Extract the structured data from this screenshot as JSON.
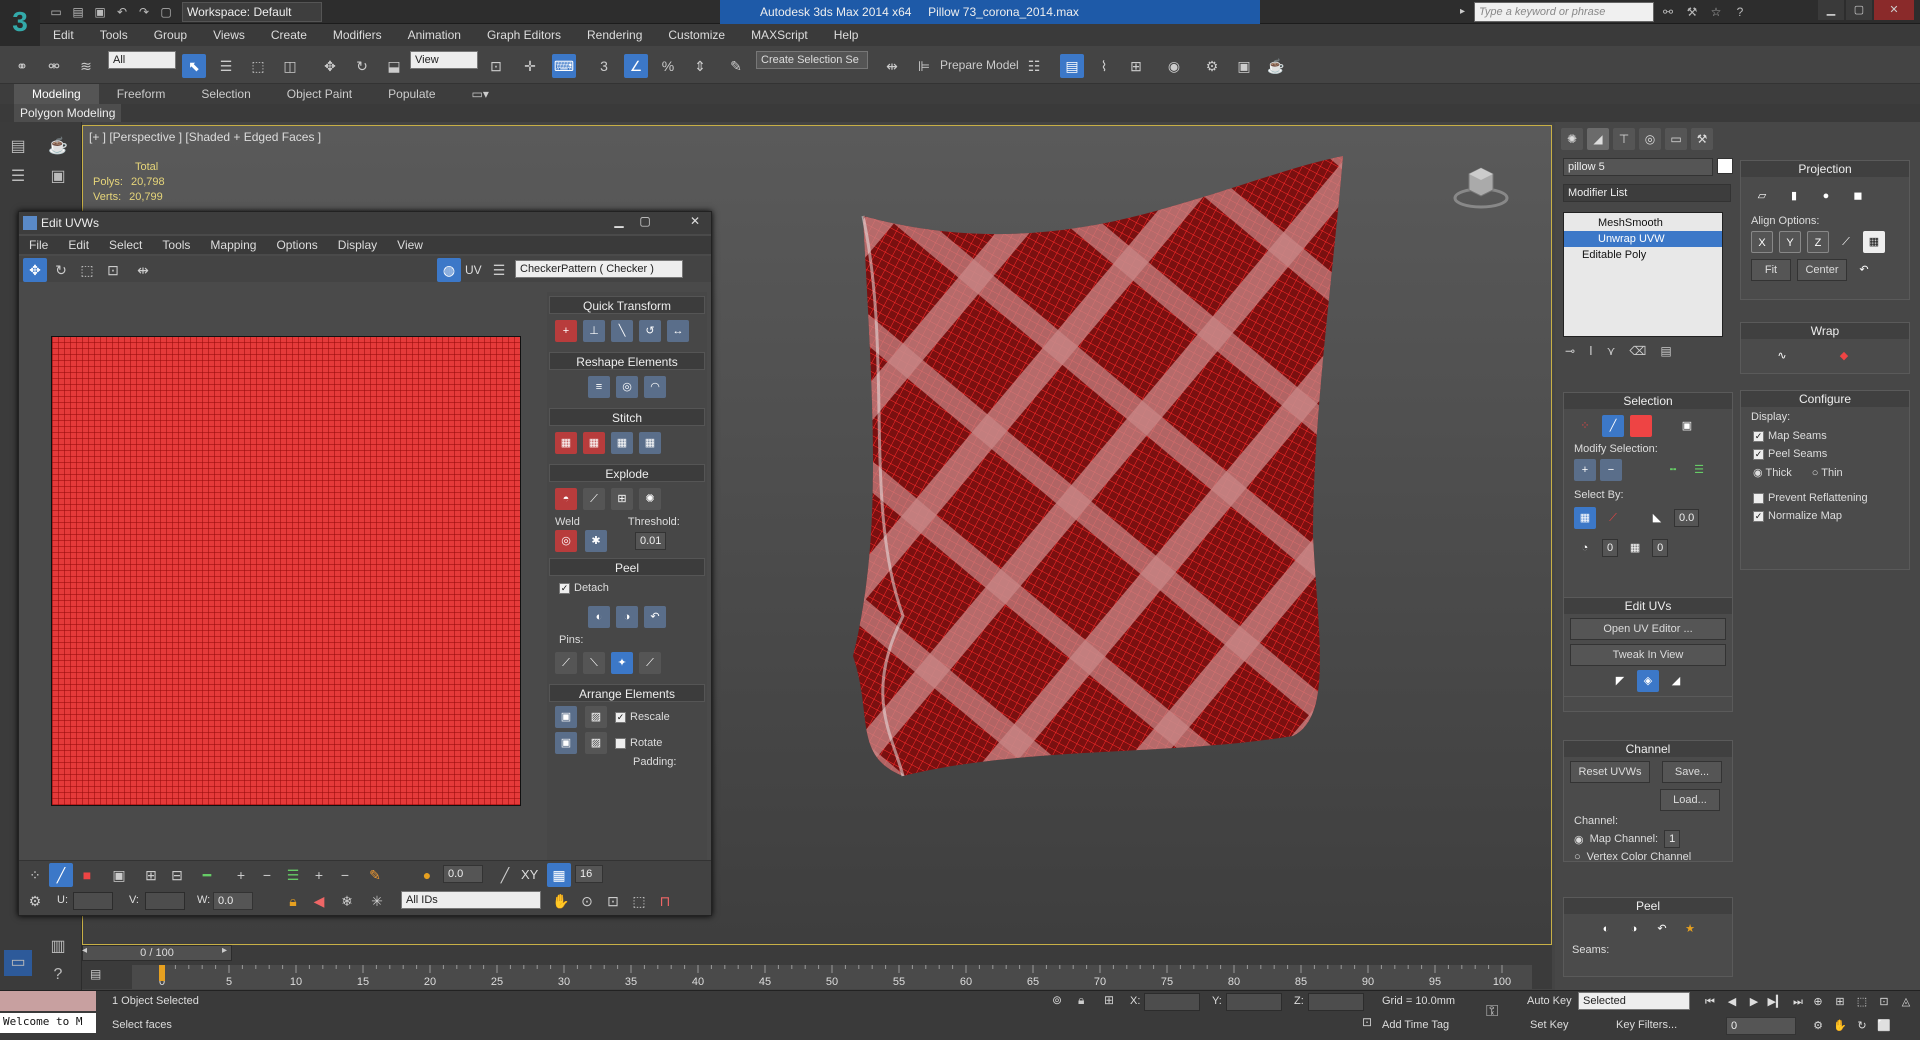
{
  "app": {
    "title": "Autodesk 3ds Max  2014 x64",
    "file": "Pillow 73_corona_2014.max",
    "workspace": "Workspace: Default",
    "search_placeholder": "Type a keyword or phrase",
    "logo": "3"
  },
  "menu": [
    "Edit",
    "Tools",
    "Group",
    "Views",
    "Create",
    "Modifiers",
    "Animation",
    "Graph Editors",
    "Rendering",
    "Customize",
    "MAXScript",
    "Help"
  ],
  "toolbar": {
    "filter": "All",
    "refcoord": "View",
    "selection_set": "Create Selection Se",
    "prepare_model": "Prepare Model"
  },
  "ribbon": {
    "tabs": [
      "Modeling",
      "Freeform",
      "Selection",
      "Object Paint",
      "Populate"
    ],
    "active": "Modeling",
    "panel_label": "Polygon Modeling"
  },
  "viewport": {
    "label": "[+ ] [Perspective ] [Shaded + Edged Faces ]",
    "stats_header": "Total",
    "polys_label": "Polys:",
    "polys": "20,798",
    "verts_label": "Verts:",
    "verts": "20,799"
  },
  "uv_editor": {
    "title": "Edit UVWs",
    "menu": [
      "File",
      "Edit",
      "Select",
      "Tools",
      "Mapping",
      "Options",
      "Display",
      "View"
    ],
    "uv_label": "UV",
    "texture": "CheckerPattern  ( Checker )",
    "panels": {
      "quick_transform": "Quick Transform",
      "reshape": "Reshape Elements",
      "stitch": "Stitch",
      "explode": "Explode",
      "weld": "Weld",
      "threshold_label": "Threshold:",
      "threshold": "0.01",
      "peel": "Peel",
      "detach": "Detach",
      "pins": "Pins:",
      "arrange": "Arrange Elements",
      "rescale": "Rescale",
      "rotate": "Rotate",
      "padding": "Padding:"
    },
    "bottom": {
      "value1": "0.0",
      "value2": "16",
      "xy": "XY",
      "u_label": "U:",
      "v_label": "V:",
      "w_label": "W:",
      "w_value": "0.0",
      "ids": "All IDs"
    }
  },
  "command_panel": {
    "object_name": "pillow 5",
    "modifier_list": "Modifier List",
    "stack": [
      "MeshSmooth",
      "Unwrap UVW",
      "Editable Poly"
    ],
    "selected_modifier": "Unwrap UVW",
    "selection": {
      "title": "Selection",
      "modify_selection": "Modify Selection:",
      "select_by": "Select By:",
      "val1": "0.0",
      "val2": "0",
      "val3": "0"
    },
    "edit_uvs": {
      "title": "Edit UVs",
      "open": "Open UV Editor ...",
      "tweak": "Tweak In View"
    },
    "channel": {
      "title": "Channel",
      "reset": "Reset UVWs",
      "save": "Save...",
      "load": "Load...",
      "channel_label": "Channel:",
      "map_channel": "Map Channel:",
      "map_channel_value": "1",
      "vertex_color": "Vertex Color Channel"
    },
    "peel": {
      "title": "Peel",
      "seams": "Seams:"
    },
    "projection": {
      "title": "Projection",
      "align_options": "Align Options:",
      "x": "X",
      "y": "Y",
      "z": "Z",
      "fit": "Fit",
      "center": "Center"
    },
    "wrap": {
      "title": "Wrap"
    },
    "configure": {
      "title": "Configure",
      "display": "Display:",
      "map_seams": "Map Seams",
      "peel_seams": "Peel Seams",
      "thick": "Thick",
      "thin": "Thin",
      "prevent": "Prevent Reflattening",
      "normalize": "Normalize Map"
    }
  },
  "timeline": {
    "slider": "0 / 100",
    "ticks": [
      "0",
      "5",
      "10",
      "15",
      "20",
      "25",
      "30",
      "35",
      "40",
      "45",
      "50",
      "55",
      "60",
      "65",
      "70",
      "75",
      "80",
      "85",
      "90",
      "95",
      "100"
    ]
  },
  "status": {
    "welcome": "Welcome to M",
    "selected": "1 Object Selected",
    "prompt": "Select faces",
    "x": "X:",
    "y": "Y:",
    "z": "Z:",
    "grid": "Grid = 10.0mm",
    "add_time_tag": "Add Time Tag",
    "auto_key": "Auto Key",
    "set_key": "Set Key",
    "selected_mode": "Selected",
    "key_filters": "Key Filters...",
    "frame": "0"
  }
}
